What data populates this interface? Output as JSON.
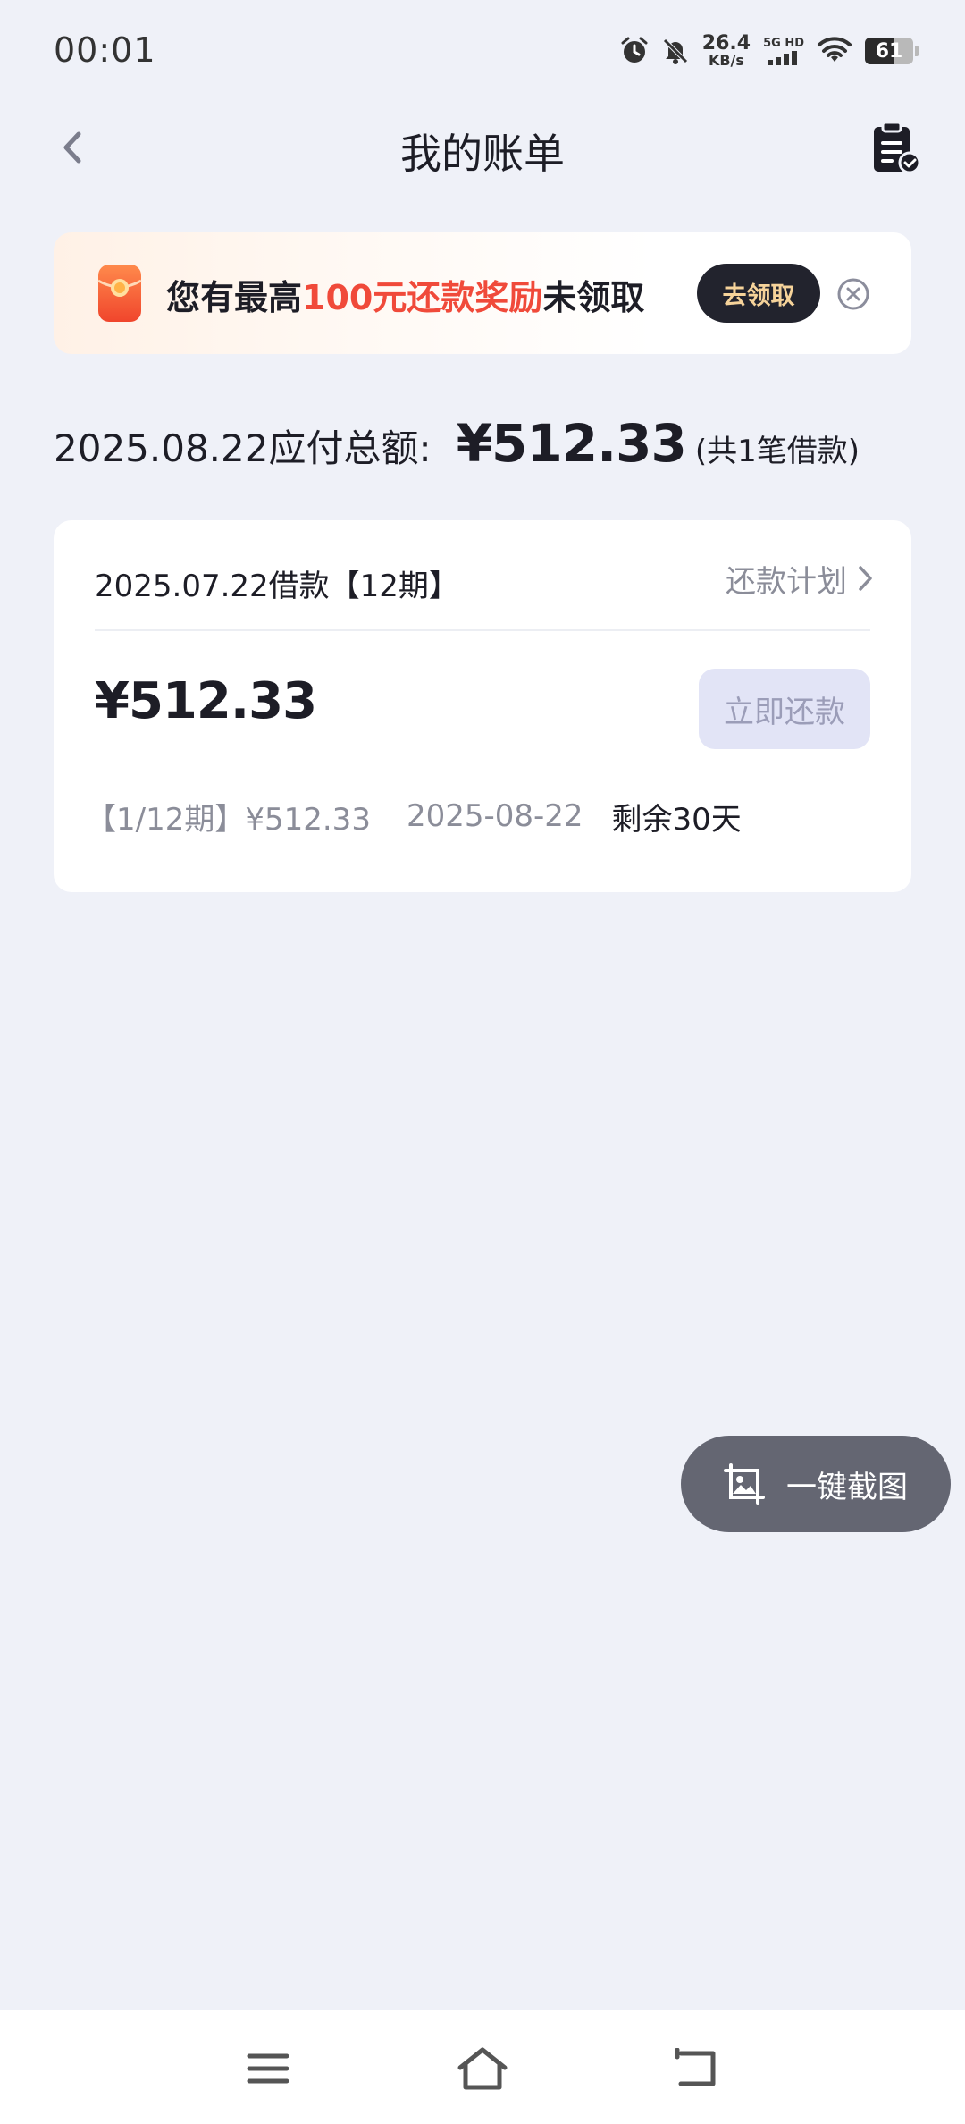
{
  "status_bar": {
    "time": "00:01",
    "net_speed": "26.4",
    "net_unit": "KB/s",
    "network_label": "5G HD",
    "battery_level": "61",
    "battery_fraction": 0.61
  },
  "header": {
    "title": "我的账单"
  },
  "banner": {
    "text_prefix": "您有最高",
    "text_highlight": "100元还款奖励",
    "text_suffix": "未领取",
    "claim_label": "去领取",
    "highlight_color": "#f04a3a"
  },
  "summary": {
    "label": "2025.08.22应付总额:",
    "amount": "¥512.33",
    "count": "(共1笔借款)"
  },
  "loan": {
    "title": "2025.07.22借款【12期】",
    "plan_label": "还款计划",
    "amount": "¥512.33",
    "pay_label": "立即还款",
    "installment": "【1/12期】¥512.33",
    "due_date": "2025-08-22",
    "remaining": "剩余30天"
  },
  "floating": {
    "screenshot_label": "一键截图"
  },
  "icons": {
    "back": "chevron-left-icon",
    "bill": "clipboard-check-icon",
    "banner": "red-envelope-icon",
    "close": "circle-x-icon",
    "plan": "chevron-right-icon",
    "screenshot": "image-crop-icon",
    "nav_menu": "menu-icon",
    "nav_home": "home-icon",
    "nav_back": "return-icon"
  }
}
